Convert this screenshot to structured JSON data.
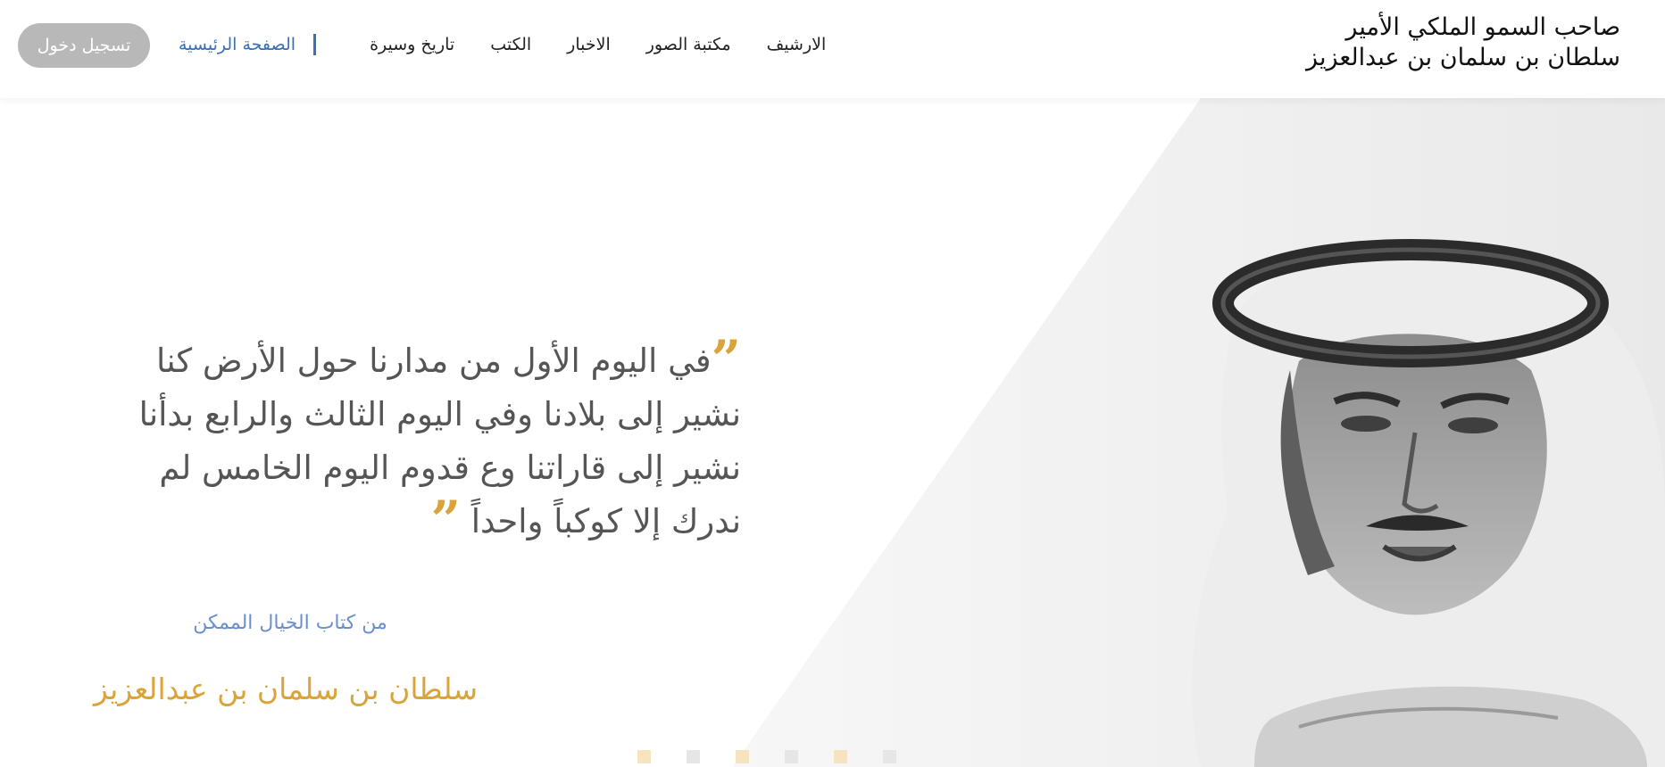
{
  "header": {
    "brand": {
      "line1": "صاحب السمو الملكي الأمير",
      "line2": "سلطان بن سلمان بن عبدالعزيز"
    },
    "nav": [
      {
        "label": "الصفحة الرئيسية",
        "active": true
      },
      {
        "label": "تاريخ وسيرة",
        "active": false
      },
      {
        "label": "الكتب",
        "active": false
      },
      {
        "label": "الاخبار",
        "active": false
      },
      {
        "label": "مكتبة الصور",
        "active": false
      },
      {
        "label": "الارشيف",
        "active": false
      }
    ],
    "login_label": "تسجيل دخول"
  },
  "hero": {
    "quote": "في اليوم الأول من مدارنا حول الأرض كنا نشير إلى بلادنا وفي اليوم الثالث والرابع بدأنا نشير إلى قاراتنا وع قدوم اليوم الخامس لم ندرك إلا كوكباً واحداً",
    "quote_open": "”",
    "quote_close": "”",
    "source": "من كتاب الخيال الممكن",
    "author": "سلطان بن سلمان بن عبدالعزيز",
    "slides_total": 6
  },
  "colors": {
    "accent_blue": "#3a6fb8",
    "gold": "#d9a43b",
    "login_bg": "#b8b8b8"
  }
}
